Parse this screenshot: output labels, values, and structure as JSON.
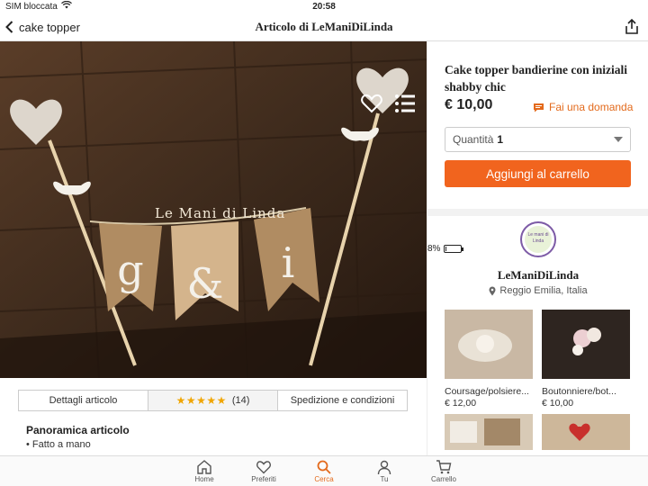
{
  "status": {
    "carrier": "SIM bloccata",
    "time": "20:58",
    "battery": "8%",
    "battery_level": 0.08
  },
  "nav": {
    "back_label": "cake topper",
    "title": "Articolo di LeManiDiLinda"
  },
  "photo": {
    "watermark": "Le Mani di Linda",
    "thumb_count": 5
  },
  "item": {
    "title": "Cake topper bandierine con iniziali shabby chic",
    "price": "€ 10,00",
    "ask_label": "Fai una domanda",
    "qty_label": "Quantità",
    "qty_value": "1",
    "cart_button": "Aggiungi al carrello"
  },
  "shop": {
    "logo_text": "Le mani di Linda",
    "name": "LeManiDiLinda",
    "location": "Reggio Emilia, Italia",
    "listings": [
      {
        "caption": "Coursage/polsiere...",
        "price": "€ 12,00"
      },
      {
        "caption": "Boutonniere/bot...",
        "price": "€ 10,00"
      },
      {
        "caption": "",
        "price": ""
      },
      {
        "caption": "",
        "price": ""
      }
    ]
  },
  "tabs": {
    "details": "Dettagli articolo",
    "stars": "★★★★★",
    "rating": 5,
    "reviews": "(14)",
    "shipping": "Spedizione e condizioni"
  },
  "overview": {
    "title": "Panoramica articolo",
    "items": [
      "• Fatto a mano"
    ]
  },
  "tabbar": {
    "home": "Home",
    "favorites": "Preferiti",
    "search": "Cerca",
    "you": "Tu",
    "cart": "Carrello"
  },
  "colors": {
    "accent": "#f1641e",
    "link": "#e36a1c",
    "star": "#f0a500"
  }
}
